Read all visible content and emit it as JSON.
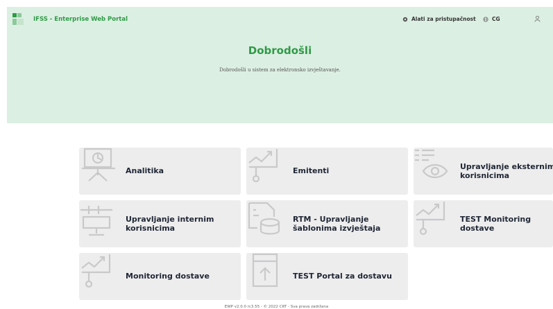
{
  "header": {
    "app_title": "IFSS - Enterprise Web Portal",
    "accessibility_label": "Alati za pristupačnost",
    "language_label": "CG",
    "welcome_title": "Dobrodošli",
    "welcome_text": "Dobrodošli u sistem za elektronsko izvještavanje."
  },
  "tiles": [
    {
      "label": "Analitika",
      "icon": "presentation-icon"
    },
    {
      "label": "Emitenti",
      "icon": "trend-chart-icon"
    },
    {
      "label": "Upravljanje eksternim\nkorisnicima",
      "icon": "eye-document-icon"
    },
    {
      "label": "Upravljanje internim\nkorisnicima",
      "icon": "monitor-settings-icon"
    },
    {
      "label": "RTM - Upravljanje\nšablonima izvještaja",
      "icon": "database-document-icon"
    },
    {
      "label": "TEST Monitoring\ndostave",
      "icon": "trend-chart-icon"
    },
    {
      "label": "Monitoring dostave",
      "icon": "trend-chart-icon"
    },
    {
      "label": "TEST Portal za dostavu",
      "icon": "upload-icon"
    }
  ],
  "footer": "EWP v2.0.0 rc3.55 - © 2022 CRT - Sva prava zadržana",
  "colors": {
    "brand_green": "#2f9a47",
    "header_bg": "#dcefe3",
    "tile_bg": "#ededee"
  }
}
